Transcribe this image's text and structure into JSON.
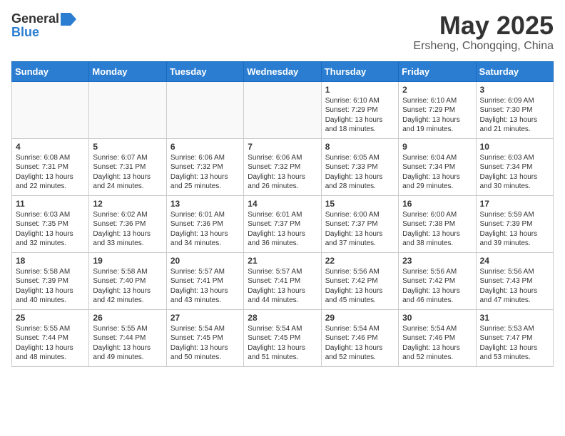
{
  "header": {
    "logo_general": "General",
    "logo_blue": "Blue",
    "month_year": "May 2025",
    "location": "Ersheng, Chongqing, China"
  },
  "weekdays": [
    "Sunday",
    "Monday",
    "Tuesday",
    "Wednesday",
    "Thursday",
    "Friday",
    "Saturday"
  ],
  "weeks": [
    [
      {
        "day": "",
        "content": ""
      },
      {
        "day": "",
        "content": ""
      },
      {
        "day": "",
        "content": ""
      },
      {
        "day": "",
        "content": ""
      },
      {
        "day": "1",
        "content": "Sunrise: 6:10 AM\nSunset: 7:29 PM\nDaylight: 13 hours\nand 18 minutes."
      },
      {
        "day": "2",
        "content": "Sunrise: 6:10 AM\nSunset: 7:29 PM\nDaylight: 13 hours\nand 19 minutes."
      },
      {
        "day": "3",
        "content": "Sunrise: 6:09 AM\nSunset: 7:30 PM\nDaylight: 13 hours\nand 21 minutes."
      }
    ],
    [
      {
        "day": "4",
        "content": "Sunrise: 6:08 AM\nSunset: 7:31 PM\nDaylight: 13 hours\nand 22 minutes."
      },
      {
        "day": "5",
        "content": "Sunrise: 6:07 AM\nSunset: 7:31 PM\nDaylight: 13 hours\nand 24 minutes."
      },
      {
        "day": "6",
        "content": "Sunrise: 6:06 AM\nSunset: 7:32 PM\nDaylight: 13 hours\nand 25 minutes."
      },
      {
        "day": "7",
        "content": "Sunrise: 6:06 AM\nSunset: 7:32 PM\nDaylight: 13 hours\nand 26 minutes."
      },
      {
        "day": "8",
        "content": "Sunrise: 6:05 AM\nSunset: 7:33 PM\nDaylight: 13 hours\nand 28 minutes."
      },
      {
        "day": "9",
        "content": "Sunrise: 6:04 AM\nSunset: 7:34 PM\nDaylight: 13 hours\nand 29 minutes."
      },
      {
        "day": "10",
        "content": "Sunrise: 6:03 AM\nSunset: 7:34 PM\nDaylight: 13 hours\nand 30 minutes."
      }
    ],
    [
      {
        "day": "11",
        "content": "Sunrise: 6:03 AM\nSunset: 7:35 PM\nDaylight: 13 hours\nand 32 minutes."
      },
      {
        "day": "12",
        "content": "Sunrise: 6:02 AM\nSunset: 7:36 PM\nDaylight: 13 hours\nand 33 minutes."
      },
      {
        "day": "13",
        "content": "Sunrise: 6:01 AM\nSunset: 7:36 PM\nDaylight: 13 hours\nand 34 minutes."
      },
      {
        "day": "14",
        "content": "Sunrise: 6:01 AM\nSunset: 7:37 PM\nDaylight: 13 hours\nand 36 minutes."
      },
      {
        "day": "15",
        "content": "Sunrise: 6:00 AM\nSunset: 7:37 PM\nDaylight: 13 hours\nand 37 minutes."
      },
      {
        "day": "16",
        "content": "Sunrise: 6:00 AM\nSunset: 7:38 PM\nDaylight: 13 hours\nand 38 minutes."
      },
      {
        "day": "17",
        "content": "Sunrise: 5:59 AM\nSunset: 7:39 PM\nDaylight: 13 hours\nand 39 minutes."
      }
    ],
    [
      {
        "day": "18",
        "content": "Sunrise: 5:58 AM\nSunset: 7:39 PM\nDaylight: 13 hours\nand 40 minutes."
      },
      {
        "day": "19",
        "content": "Sunrise: 5:58 AM\nSunset: 7:40 PM\nDaylight: 13 hours\nand 42 minutes."
      },
      {
        "day": "20",
        "content": "Sunrise: 5:57 AM\nSunset: 7:41 PM\nDaylight: 13 hours\nand 43 minutes."
      },
      {
        "day": "21",
        "content": "Sunrise: 5:57 AM\nSunset: 7:41 PM\nDaylight: 13 hours\nand 44 minutes."
      },
      {
        "day": "22",
        "content": "Sunrise: 5:56 AM\nSunset: 7:42 PM\nDaylight: 13 hours\nand 45 minutes."
      },
      {
        "day": "23",
        "content": "Sunrise: 5:56 AM\nSunset: 7:42 PM\nDaylight: 13 hours\nand 46 minutes."
      },
      {
        "day": "24",
        "content": "Sunrise: 5:56 AM\nSunset: 7:43 PM\nDaylight: 13 hours\nand 47 minutes."
      }
    ],
    [
      {
        "day": "25",
        "content": "Sunrise: 5:55 AM\nSunset: 7:44 PM\nDaylight: 13 hours\nand 48 minutes."
      },
      {
        "day": "26",
        "content": "Sunrise: 5:55 AM\nSunset: 7:44 PM\nDaylight: 13 hours\nand 49 minutes."
      },
      {
        "day": "27",
        "content": "Sunrise: 5:54 AM\nSunset: 7:45 PM\nDaylight: 13 hours\nand 50 minutes."
      },
      {
        "day": "28",
        "content": "Sunrise: 5:54 AM\nSunset: 7:45 PM\nDaylight: 13 hours\nand 51 minutes."
      },
      {
        "day": "29",
        "content": "Sunrise: 5:54 AM\nSunset: 7:46 PM\nDaylight: 13 hours\nand 52 minutes."
      },
      {
        "day": "30",
        "content": "Sunrise: 5:54 AM\nSunset: 7:46 PM\nDaylight: 13 hours\nand 52 minutes."
      },
      {
        "day": "31",
        "content": "Sunrise: 5:53 AM\nSunset: 7:47 PM\nDaylight: 13 hours\nand 53 minutes."
      }
    ]
  ]
}
